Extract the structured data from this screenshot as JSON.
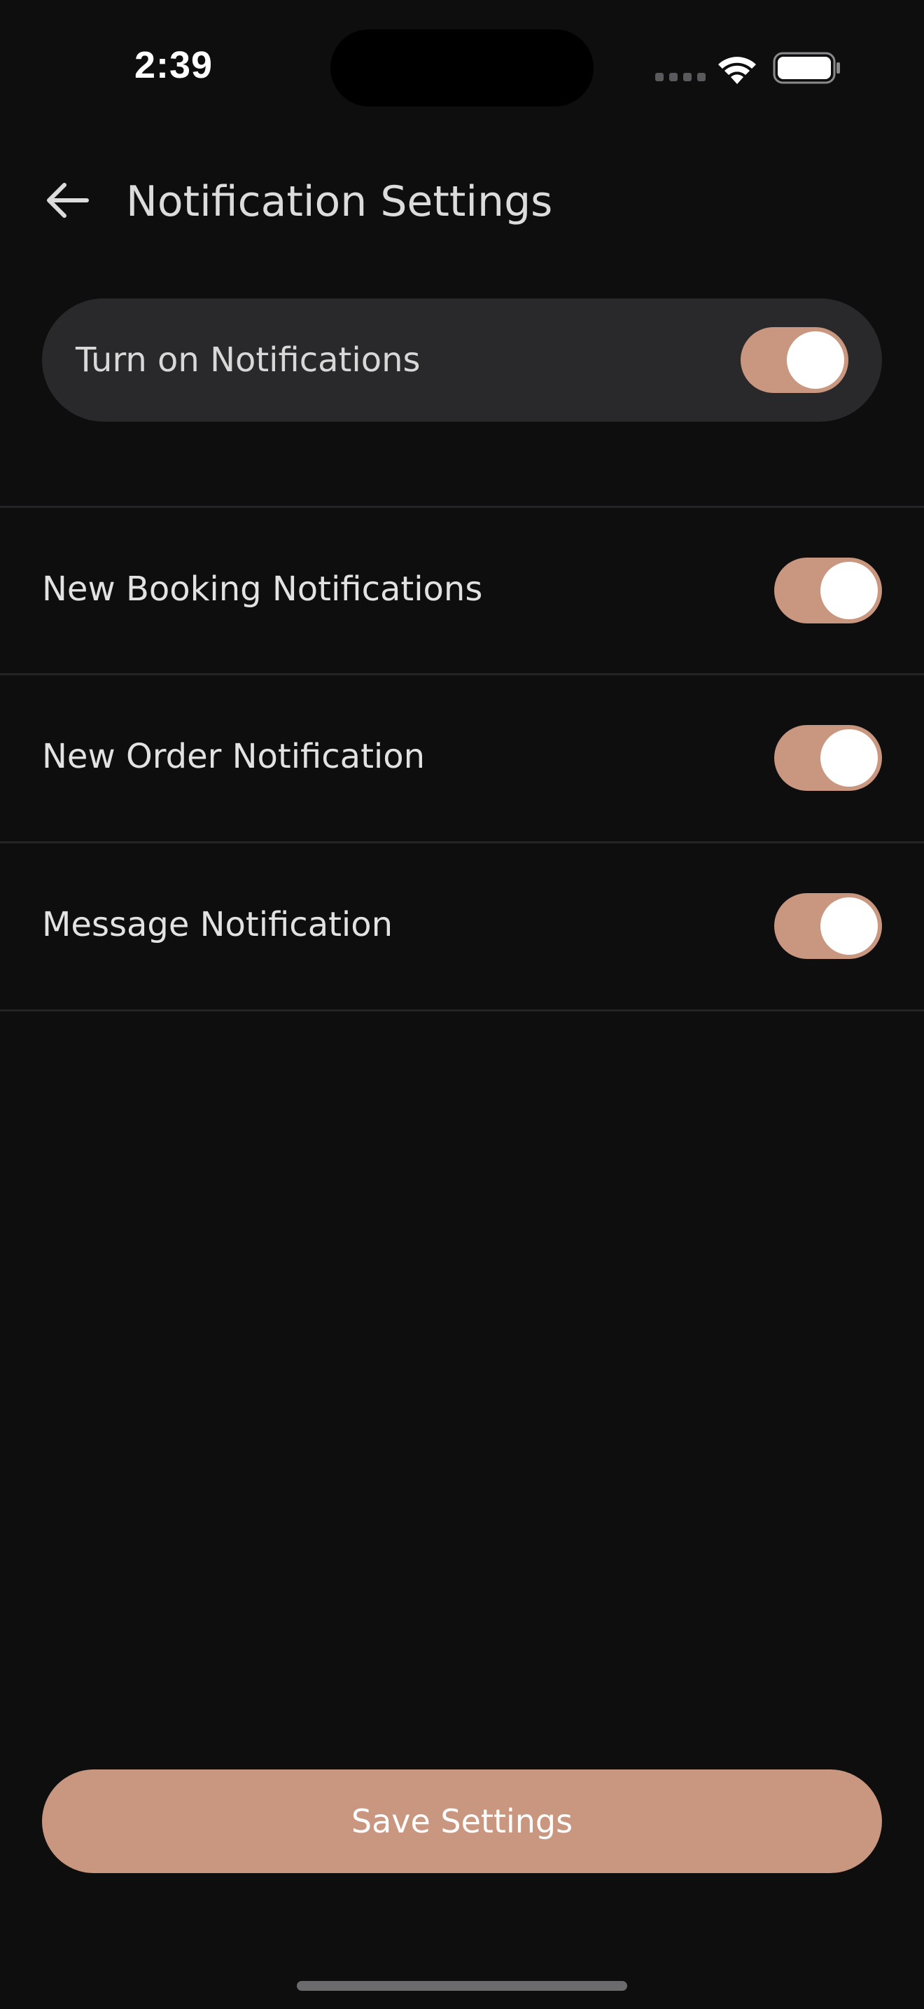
{
  "status_bar": {
    "time": "2:39"
  },
  "header": {
    "title": "Notification Settings",
    "back_icon": "arrow-left-icon"
  },
  "master_toggle": {
    "label": "Turn on Notifications",
    "enabled": true
  },
  "settings": [
    {
      "label": "New Booking Notifications",
      "enabled": true
    },
    {
      "label": "New Order Notification",
      "enabled": true
    },
    {
      "label": "Message Notification",
      "enabled": true
    }
  ],
  "actions": {
    "save_label": "Save Settings"
  },
  "colors": {
    "background": "#0e0e0f",
    "accent": "#c99680",
    "card": "#29292b",
    "divider": "#242426"
  }
}
